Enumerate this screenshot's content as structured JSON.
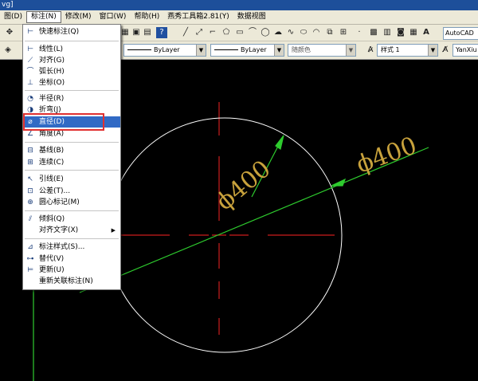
{
  "title": {
    "text": "vg]"
  },
  "menubar": {
    "items": [
      {
        "label": "图(D)"
      },
      {
        "label": "标注(N)"
      },
      {
        "label": "修改(M)"
      },
      {
        "label": "窗口(W)"
      },
      {
        "label": "帮助(H)"
      },
      {
        "label": "燕秀工具箱2.81(Y)"
      },
      {
        "label": "数据视图"
      }
    ]
  },
  "toolbar2": {
    "linetype_value": "ByLayer",
    "lineweight_value": "ByLayer",
    "color_value": "随颜色",
    "style_value": "样式 1",
    "font_value": "YanXiu"
  },
  "toolbar1": {
    "textstyle_value": "AutoCAD"
  },
  "dimension_menu": {
    "items": [
      {
        "label": "快速标注(Q)",
        "icon": "quick-dim-icon"
      },
      {
        "label": "线性(L)",
        "icon": "linear-dim-icon"
      },
      {
        "label": "对齐(G)",
        "icon": "aligned-dim-icon"
      },
      {
        "label": "弧长(H)",
        "icon": "arc-length-icon"
      },
      {
        "label": "坐标(O)",
        "icon": "ordinate-icon"
      },
      {
        "label": "半径(R)",
        "icon": "radius-icon"
      },
      {
        "label": "折弯(J)",
        "icon": "jogged-icon"
      },
      {
        "label": "直径(D)",
        "icon": "diameter-icon"
      },
      {
        "label": "角度(A)",
        "icon": "angular-icon"
      },
      {
        "label": "基线(B)",
        "icon": "baseline-icon"
      },
      {
        "label": "连续(C)",
        "icon": "continue-icon"
      },
      {
        "label": "引线(E)",
        "icon": "leader-icon"
      },
      {
        "label": "公差(T)...",
        "icon": "tolerance-icon"
      },
      {
        "label": "圆心标记(M)",
        "icon": "center-mark-icon"
      },
      {
        "label": "倾斜(Q)",
        "icon": "oblique-icon"
      },
      {
        "label": "对齐文字(X)",
        "icon": ""
      },
      {
        "label": "标注样式(S)...",
        "icon": "dim-style-icon"
      },
      {
        "label": "替代(V)",
        "icon": "override-icon"
      },
      {
        "label": "更新(U)",
        "icon": "update-icon"
      },
      {
        "label": "重新关联标注(N)",
        "icon": ""
      }
    ],
    "selected_index": 7
  },
  "drawing": {
    "dim_text_1": "ϕ400",
    "dim_text_2": "ϕ400",
    "circle_color": "#ffffff",
    "center_color": "#cc1e1e",
    "dim_line_color": "#2ecc2e",
    "dim_text_color": "#c8a23c"
  },
  "highlight_color": "#e03030"
}
